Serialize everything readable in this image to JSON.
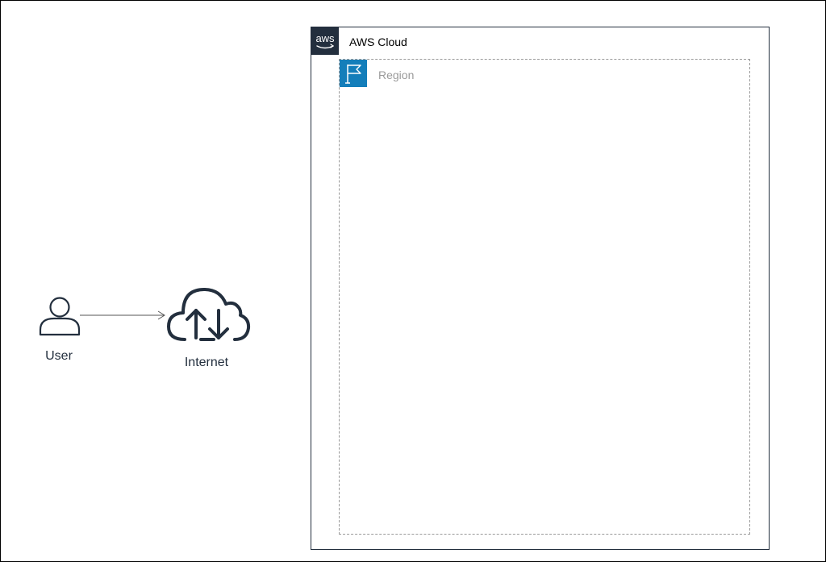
{
  "diagram": {
    "nodes": {
      "user": {
        "label": "User",
        "icon": "user-icon"
      },
      "internet": {
        "label": "Internet",
        "icon": "cloud-upload-download-icon"
      }
    },
    "edges": [
      {
        "from": "user",
        "to": "internet",
        "style": "arrow"
      }
    ],
    "groups": {
      "aws_cloud": {
        "label": "AWS Cloud",
        "icon": "aws-logo-icon",
        "border_color": "#232f3e"
      },
      "region": {
        "label": "Region",
        "icon": "flag-icon",
        "border_color": "#9a9a9a",
        "icon_bg": "#147eba",
        "parent": "aws_cloud"
      }
    }
  },
  "colors": {
    "aws_dark": "#232f3e",
    "region_blue": "#147eba",
    "muted_gray": "#9a9a9a"
  }
}
